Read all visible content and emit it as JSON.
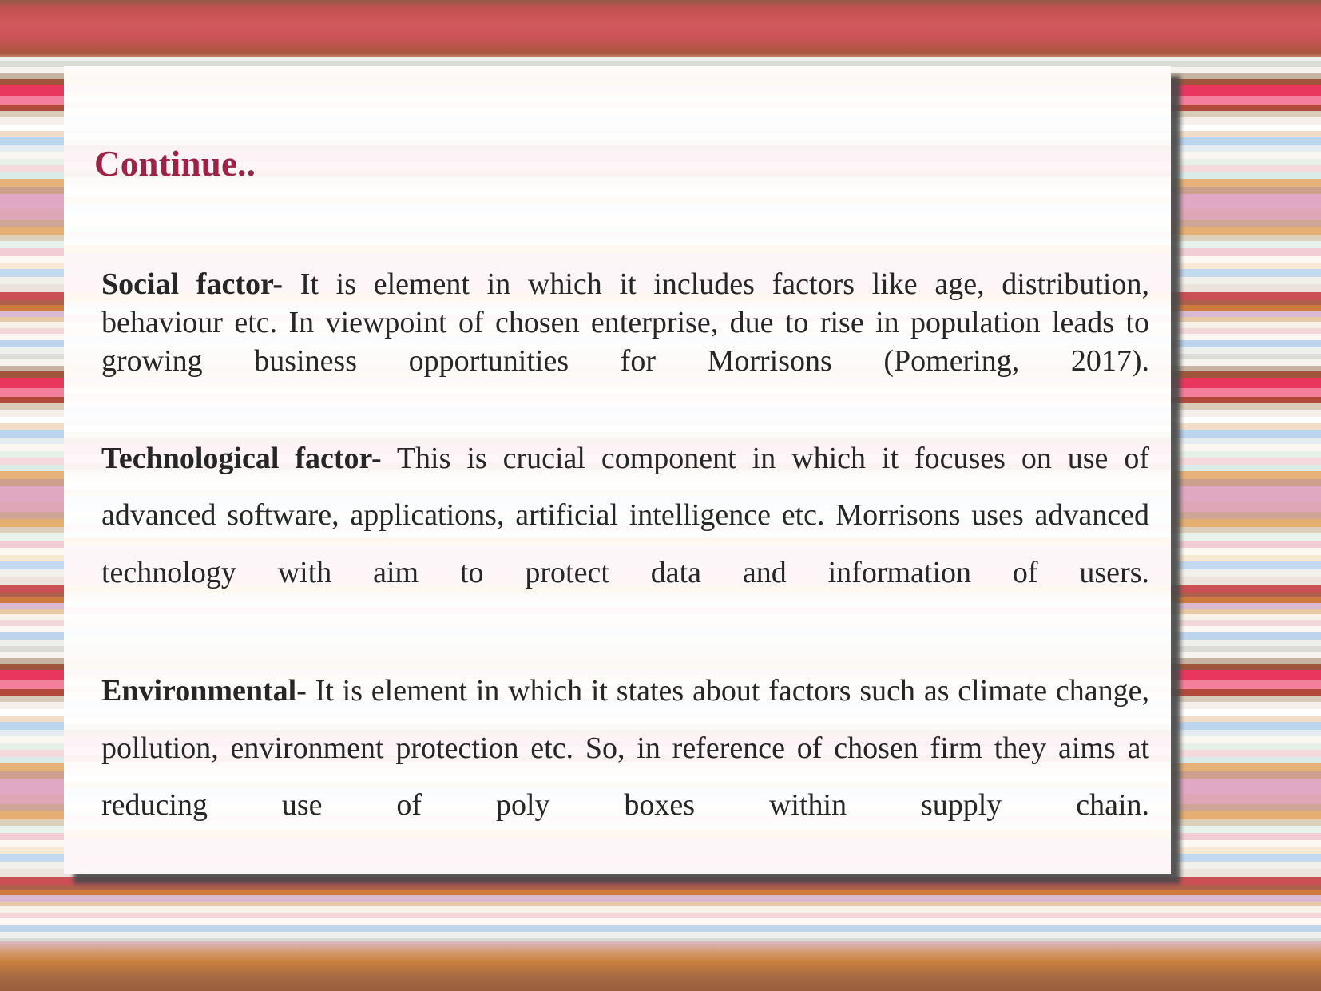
{
  "slide": {
    "title": "Continue..",
    "title_color": "#9d2247",
    "body_text_color": "#262626",
    "background": {
      "style": "horizontal-stripes",
      "top_band_color": "#cb5055",
      "bottom_band_color": "#c87f3e",
      "accent_colors": [
        "#cb5055",
        "#e8365e",
        "#cf7b3e",
        "#bdd5ec",
        "#e0a8c2",
        "#a0543c"
      ]
    },
    "paragraphs": [
      {
        "lead": "Social factor-",
        "text": "  It is element in which it includes factors like age, distribution, behaviour etc. In viewpoint of chosen enterprise, due to rise in population leads to growing business opportunities for Morrisons (Pomering, 2017).",
        "spacing": "tight"
      },
      {
        "lead": "Technological factor-",
        "text": " This is crucial component in which it focuses on use of advanced software, applications, artificial intelligence etc. Morrisons uses advanced technology with aim to protect data and information of users.",
        "spacing": "loose"
      },
      {
        "lead": "Environmental-",
        "text": " It is element in which it states about factors such as climate change, pollution, environment protection etc. So, in reference of chosen firm they aims at reducing use of  poly boxes within supply chain.",
        "spacing": "loose"
      }
    ]
  }
}
